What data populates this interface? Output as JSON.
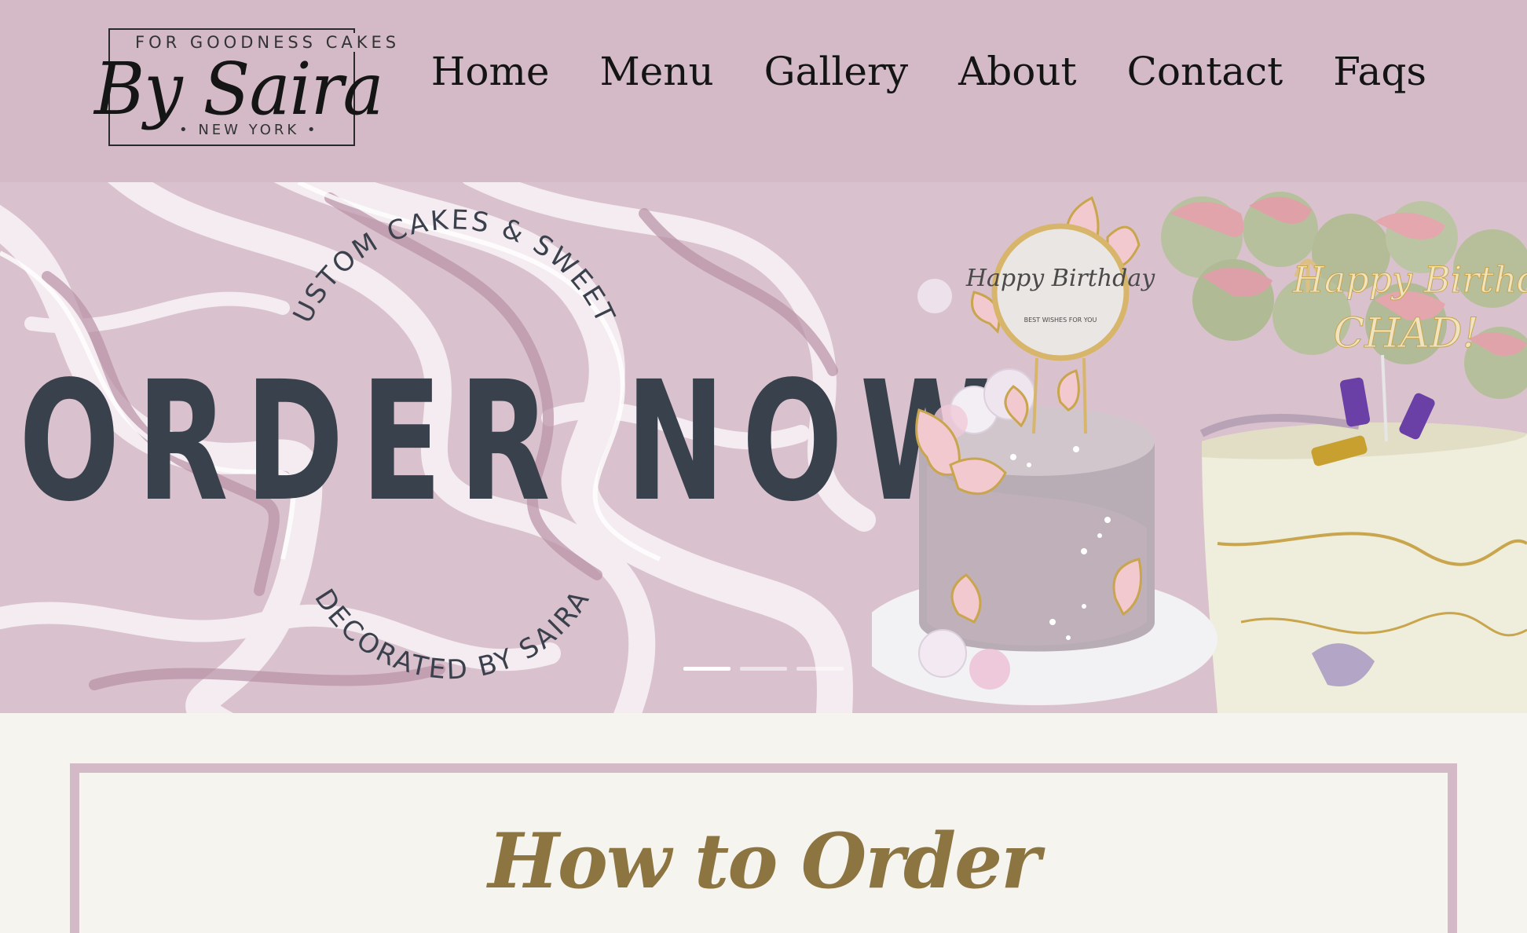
{
  "brand": {
    "tagline_top": "FOR GOODNESS CAKES",
    "script_name": "By Saira",
    "location": "• NEW YORK •"
  },
  "nav": {
    "items": [
      "Home",
      "Menu",
      "Gallery",
      "About",
      "Contact",
      "Faqs"
    ]
  },
  "hero": {
    "arc_top": "CUSTOM CAKES & SWEETS",
    "headline": "ORDER NOW",
    "arc_bottom": "DECORATED BY SAIRA",
    "topper_text": "Happy Birthday",
    "topper_small": "BEST WISHES FOR YOU",
    "topper2_text": "Happy Birthday",
    "topper2_name": "CHAD!",
    "slides": 3,
    "active_slide": 1
  },
  "section": {
    "title": "How to Order"
  },
  "colors": {
    "header_bg": "#d3bac6",
    "headline": "#39414d",
    "title_gold": "#8c7540",
    "page_bg": "#f5f4ef"
  }
}
